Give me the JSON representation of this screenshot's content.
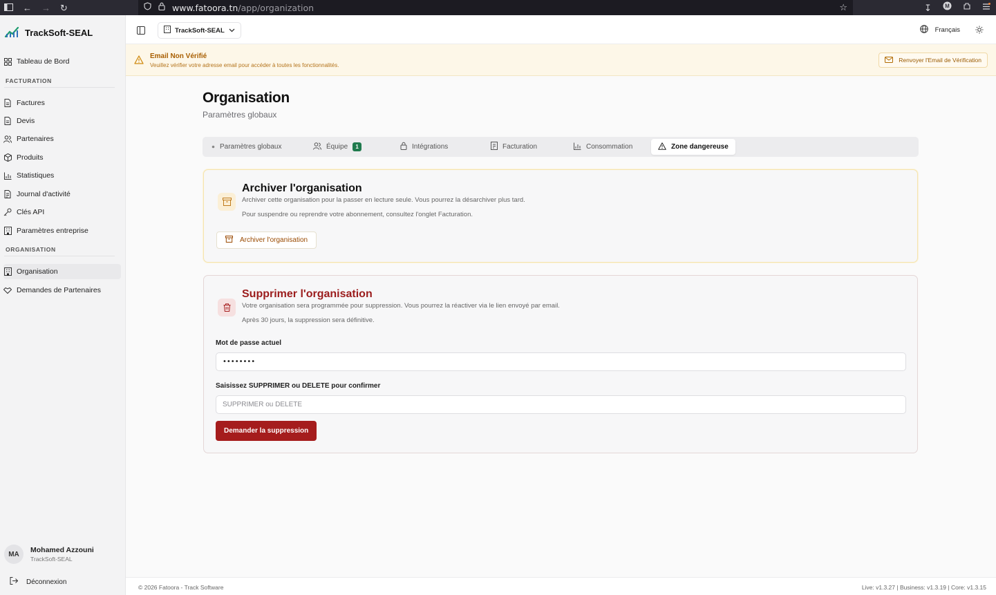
{
  "browser": {
    "url_domain": "www.fatoora.tn",
    "url_path": "/app/organization"
  },
  "sidebar": {
    "brand": "TrackSoft-SEAL",
    "top_item": "Tableau de Bord",
    "section_billing": "FACTURATION",
    "billing_items": [
      "Factures",
      "Devis",
      "Partenaires",
      "Produits",
      "Statistiques",
      "Journal d'activité",
      "Clés API",
      "Paramètres entreprise"
    ],
    "section_org": "ORGANISATION",
    "org_items": [
      "Organisation",
      "Demandes de Partenaires"
    ],
    "user": {
      "initials": "MA",
      "name": "Mohamed Azzouni",
      "org": "TrackSoft-SEAL"
    },
    "logout": "Déconnexion"
  },
  "header": {
    "org_select": "TrackSoft-SEAL",
    "language": "Français"
  },
  "banner": {
    "title": "Email Non Vérifié",
    "text": "Veuillez vérifier votre adresse email pour accéder à toutes les fonctionnalités.",
    "button": "Renvoyer l'Email de Vérification"
  },
  "page": {
    "title": "Organisation",
    "subtitle": "Paramètres globaux"
  },
  "tabs": [
    {
      "label": "Paramètres globaux"
    },
    {
      "label": "Équipe",
      "badge": "1"
    },
    {
      "label": "Intégrations"
    },
    {
      "label": "Facturation"
    },
    {
      "label": "Consommation"
    },
    {
      "label": "Zone dangereuse",
      "active": true
    }
  ],
  "archive_card": {
    "title": "Archiver l'organisation",
    "line1": "Archiver cette organisation pour la passer en lecture seule. Vous pourrez la désarchiver plus tard.",
    "line2": "Pour suspendre ou reprendre votre abonnement, consultez l'onglet Facturation.",
    "button": "Archiver l'organisation"
  },
  "delete_card": {
    "title": "Supprimer l'organisation",
    "line1": "Votre organisation sera programmée pour suppression. Vous pourrez la réactiver via le lien envoyé par email.",
    "line2": "Après 30 jours, la suppression sera définitive.",
    "password_label": "Mot de passe actuel",
    "password_value": "••••••••",
    "confirm_label": "Saisissez SUPPRIMER ou DELETE pour confirmer",
    "confirm_placeholder": "SUPPRIMER ou DELETE",
    "button": "Demander la suppression"
  },
  "footer": {
    "left": "© 2026 Fatoora - Track Software",
    "right": "Live: v1.3.27 | Business: v1.3.19 | Core: v1.3.15"
  },
  "colors": {
    "danger": "#a51d1d",
    "warning": "#a85e00",
    "badge_green": "#1f7a4d"
  }
}
